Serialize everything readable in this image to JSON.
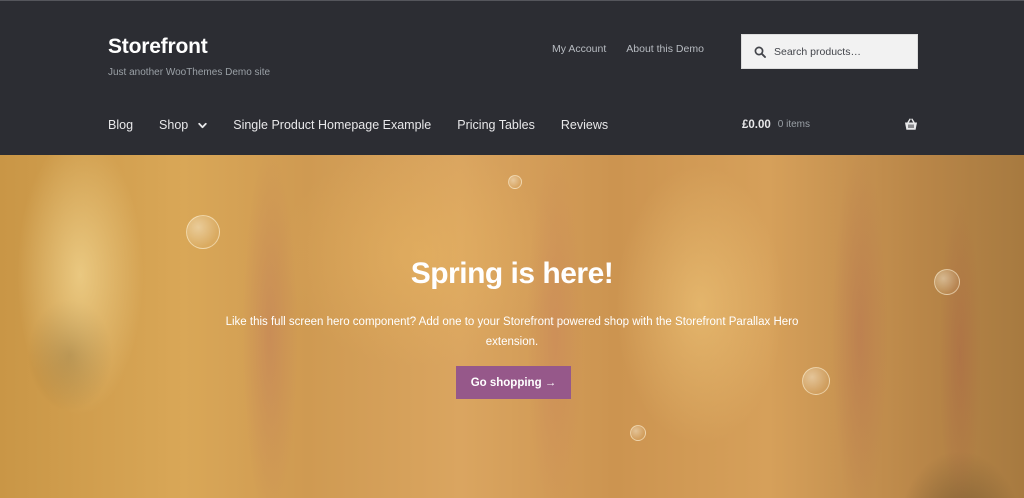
{
  "site": {
    "title": "Storefront",
    "tagline": "Just another WooThemes Demo site"
  },
  "secondary_nav": {
    "items": [
      {
        "label": "My Account"
      },
      {
        "label": "About this Demo"
      }
    ]
  },
  "search": {
    "placeholder": "Search products…",
    "icon": "search-icon"
  },
  "primary_nav": {
    "items": [
      {
        "label": "Blog"
      },
      {
        "label": "Shop",
        "has_dropdown": true
      },
      {
        "label": "Single Product Homepage Example"
      },
      {
        "label": "Pricing Tables"
      },
      {
        "label": "Reviews"
      }
    ]
  },
  "cart": {
    "amount": "£0.00",
    "count": "0 items",
    "icon": "basket-icon"
  },
  "hero": {
    "title": "Spring is here!",
    "text": "Like this full screen hero component? Add one to your Storefront powered shop with the Storefront Parallax Hero extension.",
    "button_label": "Go shopping →"
  },
  "colors": {
    "header_bg": "#2c2d33",
    "accent": "#96588a",
    "hero_text": "#ffffff"
  }
}
